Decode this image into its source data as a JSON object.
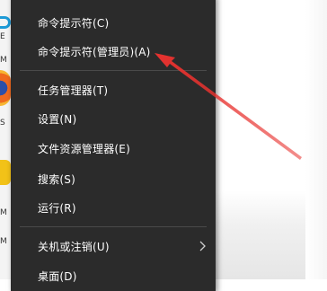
{
  "menu": {
    "items": [
      {
        "label": "命令提示符(C)"
      },
      {
        "label": "命令提示符(管理员)(A)"
      },
      {
        "label": "任务管理器(T)"
      },
      {
        "label": "设置(N)"
      },
      {
        "label": "文件资源管理器(E)"
      },
      {
        "label": "搜索(S)"
      },
      {
        "label": "运行(R)"
      },
      {
        "label": "关机或注销(U)"
      },
      {
        "label": "桌面(D)"
      }
    ]
  },
  "desktop": {
    "edge_letters": [
      "E",
      "M",
      "S",
      "M",
      "M"
    ]
  },
  "colors": {
    "menu_background": "#2b2b2b",
    "menu_text": "#ffffff",
    "separator": "#4a4a4a",
    "annotation_arrow": "#e8322f"
  },
  "icons": {
    "submenu_indicator": "chevron-right-icon",
    "annotation": "red-arrow-icon"
  }
}
